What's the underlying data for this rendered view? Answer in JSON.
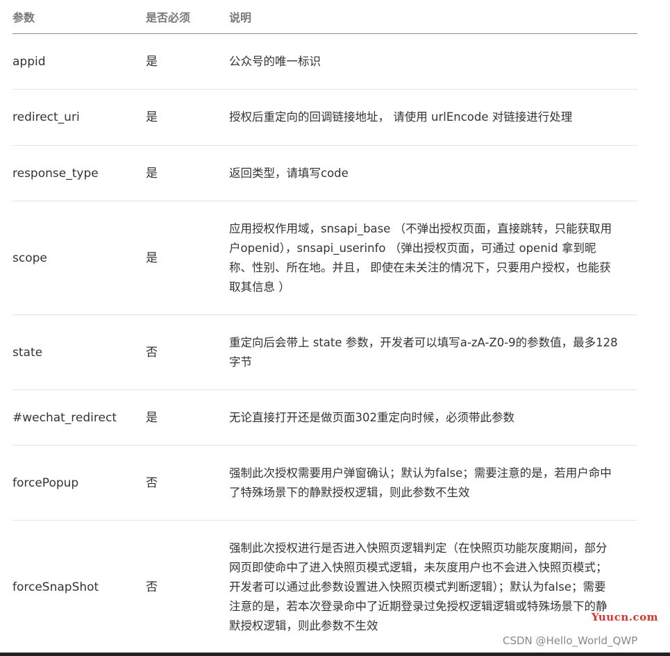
{
  "table": {
    "headers": {
      "param": "参数",
      "required": "是否必须",
      "description": "说明"
    },
    "rows": [
      {
        "param": "appid",
        "required": "是",
        "description_lines": [
          "公众号的唯一标识"
        ]
      },
      {
        "param": "redirect_uri",
        "required": "是",
        "description_lines": [
          "授权后重定向的回调链接地址， 请使用 urlEncode 对链接进行处理"
        ]
      },
      {
        "param": "response_type",
        "required": "是",
        "description_lines": [
          "返回类型，请填写code"
        ]
      },
      {
        "param": "scope",
        "required": "是",
        "description_lines": [
          "应用授权作用域，snsapi_base （不弹出授权页面，直接跳转，只能获取用",
          "户openid），snsapi_userinfo （弹出授权页面，可通过 openid 拿到昵",
          "称、性别、所在地。并且， 即使在未关注的情况下，只要用户授权，也能获",
          "取其信息 ）"
        ]
      },
      {
        "param": "state",
        "required": "否",
        "description_lines": [
          "重定向后会带上 state 参数，开发者可以填写a-zA-Z0-9的参数值，最多128",
          "字节"
        ]
      },
      {
        "param": "#wechat_redirect",
        "required": "是",
        "description_lines": [
          "无论直接打开还是做页面302重定向时候，必须带此参数"
        ]
      },
      {
        "param": "forcePopup",
        "required": "否",
        "description_lines": [
          "强制此次授权需要用户弹窗确认；默认为false；需要注意的是，若用户命中",
          "了特殊场景下的静默授权逻辑，则此参数不生效"
        ]
      },
      {
        "param": "forceSnapShot",
        "required": "否",
        "description_lines": [
          "强制此次授权进行是否进入快照页逻辑判定（在快照页功能灰度期间，部分",
          "网页即使命中了进入快照页模式逻辑，未灰度用户也不会进入快照页模式；",
          "开发者可以通过此参数设置进入快照页模式判断逻辑）；默认为false；需要",
          "注意的是，若本次登录命中了近期登录过免授权逻辑逻辑或特殊场景下的静",
          "默授权逻辑，则此参数不生效"
        ]
      }
    ]
  },
  "watermarks": {
    "site": "Yuucn.com",
    "author": "CSDN @Hello_World_QWP"
  },
  "colors": {
    "header_text": "#777777",
    "body_text": "#333333",
    "header_rule": "#888888",
    "row_rule": "#e4e4e4",
    "site_watermark": "#e0322b"
  }
}
